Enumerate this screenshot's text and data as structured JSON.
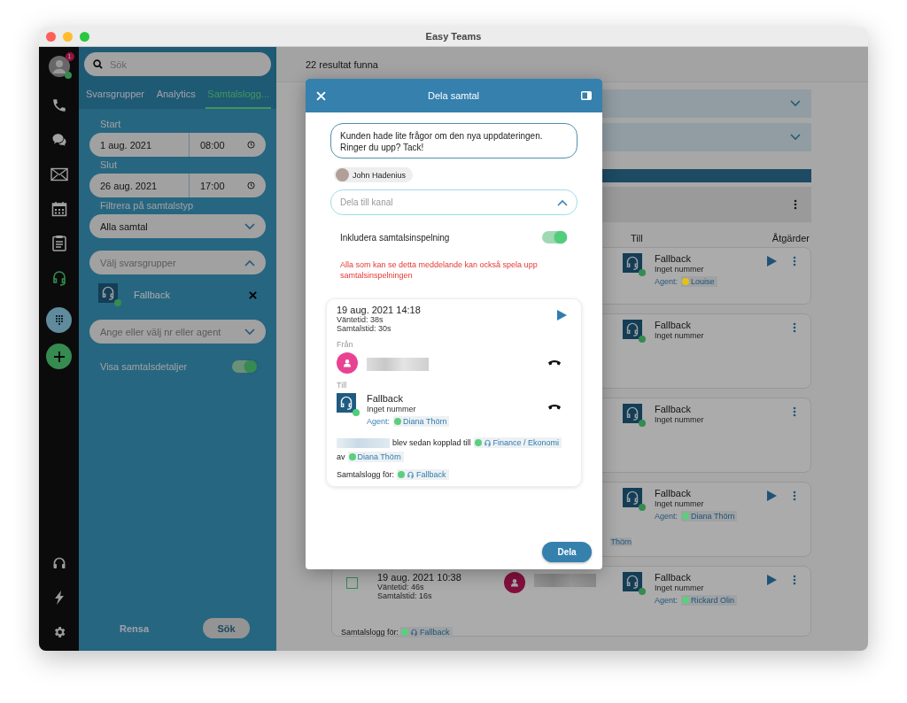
{
  "window": {
    "title": "Easy Teams"
  },
  "rail": {
    "profile": {
      "badge": "1",
      "online": true
    },
    "nav": [
      {
        "kind": "phone",
        "selected": false
      },
      {
        "kind": "chat",
        "selected": false
      },
      {
        "kind": "mail",
        "selected": false
      },
      {
        "kind": "calendar",
        "selected": false
      },
      {
        "kind": "clipboard",
        "selected": false
      },
      {
        "kind": "headset",
        "selected": true
      }
    ],
    "actions": [
      {
        "kind": "dialpad"
      },
      {
        "kind": "add"
      }
    ],
    "bottom": [
      {
        "kind": "headphones"
      },
      {
        "kind": "bolt"
      },
      {
        "kind": "settings"
      }
    ]
  },
  "sidebar": {
    "search": {
      "placeholder": "Sök"
    },
    "tabs": [
      {
        "label": "Svarsgrupper",
        "selected": false
      },
      {
        "label": "Analytics",
        "selected": false
      },
      {
        "label": "Samtalslogg...",
        "selected": true
      }
    ],
    "start_label": "Start",
    "start_date": "1 aug. 2021",
    "start_time": "08:00",
    "end_label": "Slut",
    "end_date": "26 aug. 2021",
    "end_time": "17:00",
    "filter_label": "Filtrera på samtalstyp",
    "filter_value": "Alla samtal",
    "group_select": {
      "placeholder": "Välj svarsgrupper",
      "expanded": true
    },
    "groups": [
      {
        "name": "Fallback",
        "online": true
      }
    ],
    "agent_select": {
      "placeholder": "Ange eller välj nr eller agent",
      "expanded": false
    },
    "details_toggle": {
      "label": "Visa samtalsdetaljer",
      "on": true
    },
    "clear_button": "Rensa",
    "search_button": "Sök"
  },
  "main": {
    "result_count": "22 resultat funna",
    "columns": [
      "Till",
      "Åtgärder"
    ],
    "cards": [
      {
        "to_name": "Fallback",
        "to_number": "Inget nummer",
        "agent_label": "Agent:",
        "agent": "Louise",
        "color": "#e2c11a",
        "playable": true
      },
      {
        "to_name": "Fallback",
        "to_number": "Inget nummer",
        "playable": false
      },
      {
        "to_name": "Fallback",
        "to_number": "Inget nummer",
        "playable": false
      },
      {
        "to_name": "Fallback",
        "to_number": "Inget nummer",
        "agent_label": "Agent:",
        "agent": "Diana Thörn",
        "color": "#5ccf7e",
        "playable": true,
        "note": "Thörn"
      },
      {
        "checked": false,
        "datetime": "19 aug. 2021 10:38",
        "wait": "Väntetid: 46s",
        "duration": "Samtalstid: 16s",
        "to_name": "Fallback",
        "to_number": "Inget nummer",
        "agent_label": "Agent:",
        "agent": "Rickard Olin",
        "color": "#5ccf7e",
        "playable": true,
        "log_label": "Samtalslogg för:",
        "log_group": "Fallback"
      }
    ]
  },
  "dialog": {
    "title": "Dela samtal",
    "message": "Kunden hade lite frågor om den nya uppdateringen. Ringer du upp? Tack!",
    "recipients": [
      {
        "name": "John Hadenius"
      }
    ],
    "channel": {
      "placeholder": "Dela till kanal",
      "expanded": true
    },
    "recording_toggle": {
      "label": "Inkludera samtalsinspelning",
      "on": true
    },
    "warning": "Alla som kan se detta meddelande kan också spela upp samtalsinspelningen",
    "call": {
      "datetime": "19 aug. 2021 14:18",
      "wait": "Väntetid: 38s",
      "duration": "Samtalstid: 30s",
      "from_label": "Från",
      "to_label": "Till",
      "to_name": "Fallback",
      "to_number": "Inget nummer",
      "agent_label": "Agent:",
      "agent": "Diana Thörn",
      "transfer_text": "blev sedan kopplad till",
      "transfer_group": "Finance / Ekonomi",
      "by_label": "av",
      "by_agent": "Diana Thörn",
      "log_label": "Samtalslogg för:",
      "log_group": "Fallback"
    },
    "share_button": "Dela"
  }
}
